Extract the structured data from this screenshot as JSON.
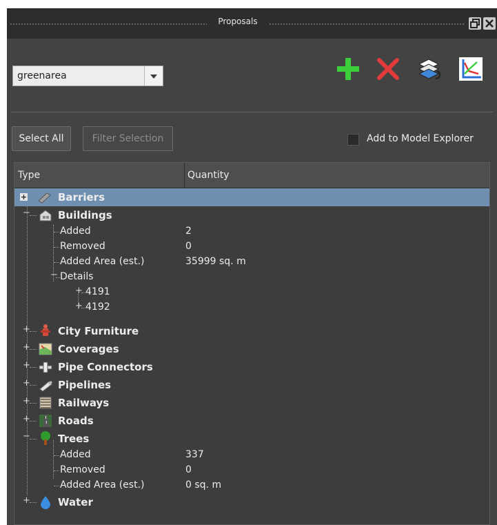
{
  "window": {
    "title": "Proposals"
  },
  "proposal_select": {
    "value": "greenarea"
  },
  "toolbar": {
    "add_icon": "add-icon",
    "delete_icon": "delete-icon",
    "layers_icon": "layers-icon",
    "chart_icon": "chart-icon"
  },
  "buttons": {
    "select_all": "Select All",
    "filter_selection": "Filter Selection"
  },
  "checkbox": {
    "label": "Add to Model Explorer",
    "checked": false
  },
  "table": {
    "col_type": "Type",
    "col_quantity": "Quantity"
  },
  "tree": {
    "barriers": "Barriers",
    "buildings": {
      "label": "Buildings",
      "added_label": "Added",
      "added_value": "2",
      "removed_label": "Removed",
      "removed_value": "0",
      "area_label": "Added Area (est.)",
      "area_value": "35999 sq. m",
      "details_label": "Details",
      "detail_1": "4191",
      "detail_2": "4192"
    },
    "city_furniture": "City Furniture",
    "coverages": "Coverages",
    "pipe_connectors": "Pipe Connectors",
    "pipelines": "Pipelines",
    "railways": "Railways",
    "roads": "Roads",
    "trees": {
      "label": "Trees",
      "added_label": "Added",
      "added_value": "337",
      "removed_label": "Removed",
      "removed_value": "0",
      "area_label": "Added Area (est.)",
      "area_value": "0 sq. m"
    },
    "water": "Water"
  },
  "colors": {
    "selection": "#6e8fb0",
    "add": "#3ccf3c",
    "delete": "#e03a3a"
  }
}
